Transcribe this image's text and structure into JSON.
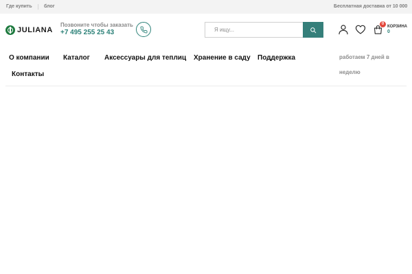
{
  "topbar": {
    "where_to_buy": "Где купить",
    "blog": "блог",
    "shipping_note": "Бесплатная доставка от 10 000"
  },
  "logo": {
    "text": "JULIANA"
  },
  "contact": {
    "caption": "Позвоните чтобы заказать",
    "phone": "+7 495 255 25 43"
  },
  "search": {
    "placeholder": "Я ищу..."
  },
  "cart": {
    "badge": "0",
    "label": "КОРЗИНА",
    "count": "0"
  },
  "nav": {
    "items": [
      "О компании",
      "Каталог",
      "Аксессуары для теплиц",
      "Хранение в саду",
      "Поддержка",
      "Контакты"
    ]
  },
  "hours": {
    "line1": "работаем 7 дней в",
    "line2": "неделю"
  },
  "colors": {
    "accent": "#2c8178",
    "search_button": "#357f7a",
    "badge": "#e4473b",
    "topbar_bg": "#f3f3f3"
  },
  "icons": {
    "phone": "phone-icon",
    "search": "search-icon",
    "account": "user-icon",
    "wishlist": "heart-icon",
    "cart": "shopping-bag-icon"
  }
}
